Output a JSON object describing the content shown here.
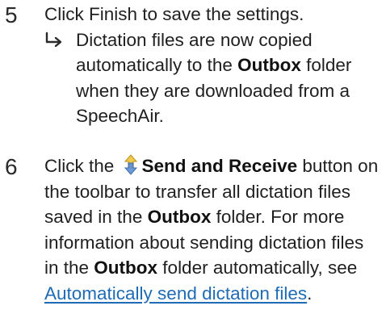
{
  "steps": [
    {
      "number": "5",
      "text": "Click Finish to save the settings.",
      "result": {
        "part1": "Dictation files are now copied automatically to the ",
        "bold1": "Outbox",
        "part2": " folder when they are downloaded from a SpeechAir."
      }
    },
    {
      "number": "6",
      "part1": "Click the ",
      "icon": "send-and-receive-icon",
      "bold1": "Send and Receive",
      "part2": " button on the toolbar to transfer all dictation files saved in the ",
      "bold2": "Outbox",
      "part3": " folder. For more information about sending dictation files in the ",
      "bold3": "Outbox",
      "part4": " folder automatically, see ",
      "link": "Automatically send dictation files",
      "part5": "."
    }
  ],
  "colors": {
    "text": "#1f1f1f",
    "link": "#1f6bb5",
    "icon_yellow": "#f2c94c",
    "icon_blue": "#5b8fd6"
  }
}
